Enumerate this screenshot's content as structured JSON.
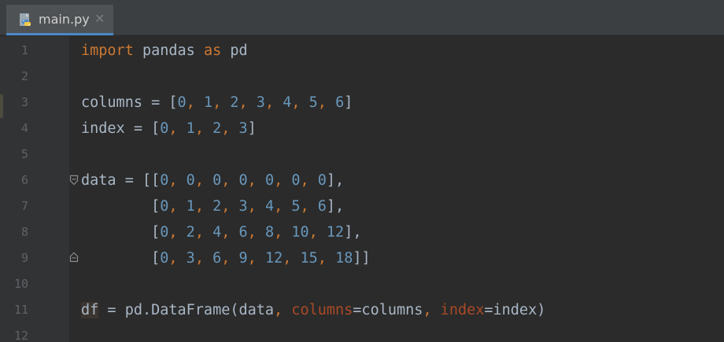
{
  "tab": {
    "filename": "main.py",
    "close_glyph": "✕",
    "icon": "python-file-icon"
  },
  "colors": {
    "background": "#2b2b2b",
    "keyword": "#cc7832",
    "number": "#6897bb",
    "identifier": "#a9b7c6",
    "named_param": "#aa4926",
    "line_number": "#606366",
    "tab_underline": "#4a88c7"
  },
  "line_numbers": [
    "1",
    "2",
    "3",
    "4",
    "5",
    "6",
    "7",
    "8",
    "9",
    "10",
    "11",
    "12"
  ],
  "code": {
    "l1": {
      "kw_import": "import",
      "module": " pandas ",
      "kw_as": "as",
      "alias": " pd"
    },
    "l3": {
      "prefix": "columns = [",
      "values": [
        "0",
        "1",
        "2",
        "3",
        "4",
        "5",
        "6"
      ],
      "suffix": "]"
    },
    "l4": {
      "prefix": "index = [",
      "values": [
        "0",
        "1",
        "2",
        "3"
      ],
      "suffix": "]"
    },
    "l6": {
      "prefix": "data = [[",
      "values": [
        "0",
        "0",
        "0",
        "0",
        "0",
        "0",
        "0"
      ],
      "suffix": "],"
    },
    "l7": {
      "prefix": "        [",
      "values": [
        "0",
        "1",
        "2",
        "3",
        "4",
        "5",
        "6"
      ],
      "suffix": "],"
    },
    "l8": {
      "prefix": "        [",
      "values": [
        "0",
        "2",
        "4",
        "6",
        "8",
        "10",
        "12"
      ],
      "suffix": "],"
    },
    "l9": {
      "prefix": "        [",
      "values": [
        "0",
        "3",
        "6",
        "9",
        "12",
        "15",
        "18"
      ],
      "suffix": "]]"
    },
    "l11": {
      "var": "df",
      "call": " = pd.DataFrame(data",
      "comma1": ",",
      "param1": " columns",
      "eq1": "=columns",
      "comma2": ",",
      "param2": " index",
      "eq2": "=index)"
    }
  }
}
